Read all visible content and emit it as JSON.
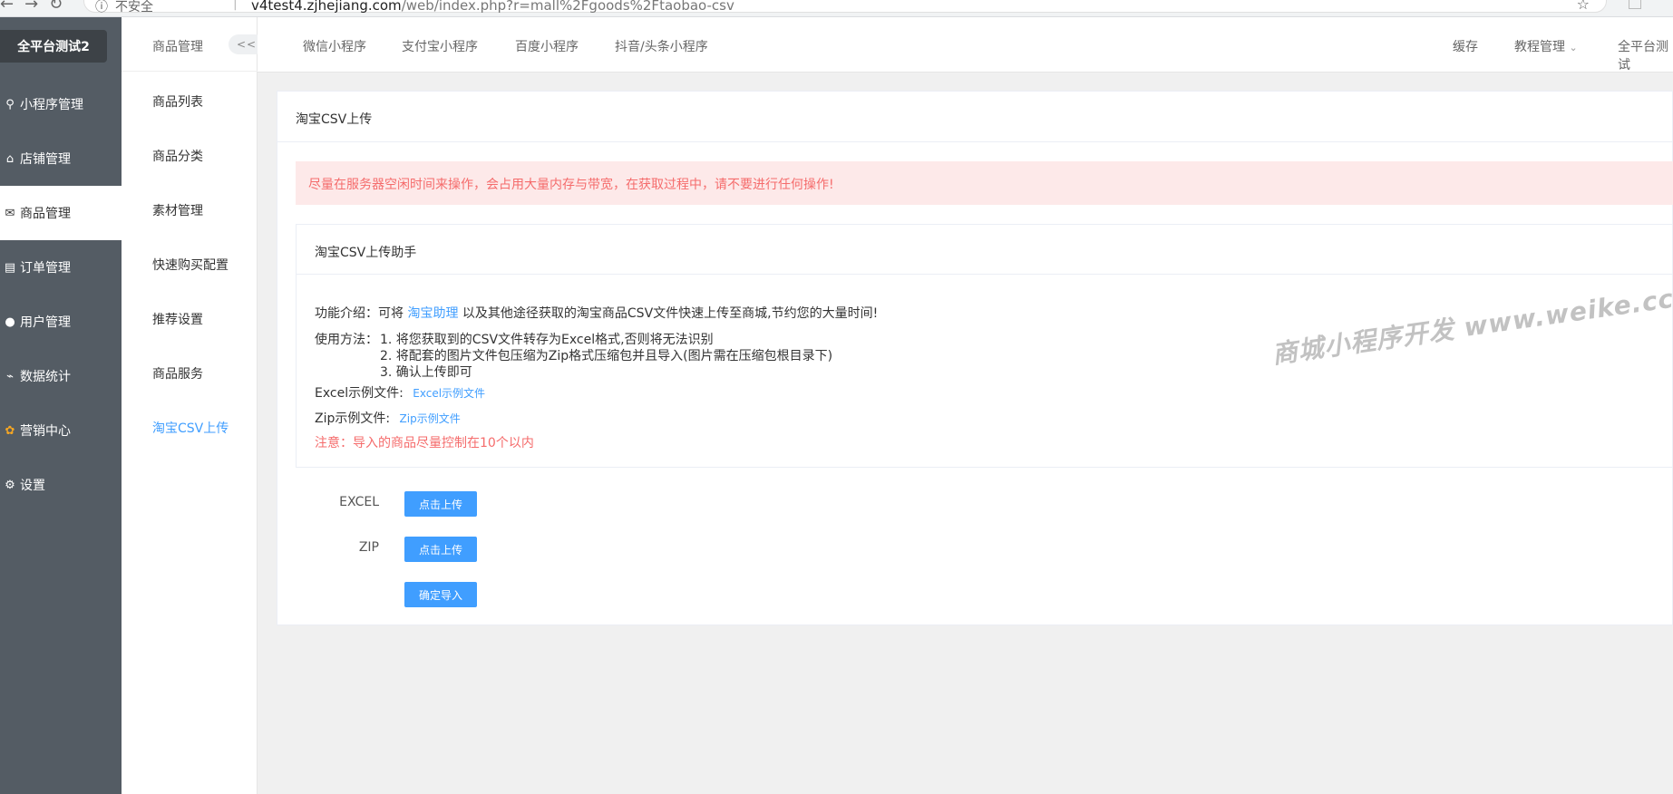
{
  "browser": {
    "secure_label": "不安全",
    "url_host": "v4test4.zjhejiang.com",
    "url_path": "/web/index.php?r=mall%2Fgoods%2Ftaobao-csv"
  },
  "sidebar": {
    "brand": "全平台测试2",
    "items": [
      {
        "label": "小程序管理",
        "icon": "link-icon"
      },
      {
        "label": "店铺管理",
        "icon": "store-icon"
      },
      {
        "label": "商品管理",
        "icon": "goods-icon"
      },
      {
        "label": "订单管理",
        "icon": "order-icon"
      },
      {
        "label": "用户管理",
        "icon": "user-icon"
      },
      {
        "label": "数据统计",
        "icon": "chart-icon"
      },
      {
        "label": "营销中心",
        "icon": "marketing-icon"
      },
      {
        "label": "设置",
        "icon": "gear-icon"
      }
    ]
  },
  "subnav": {
    "title": "商品管理",
    "collapse": "<<",
    "items": [
      "商品列表",
      "商品分类",
      "素材管理",
      "快速购买配置",
      "推荐设置",
      "商品服务",
      "淘宝CSV上传"
    ]
  },
  "topnav": {
    "tabs": [
      "微信小程序",
      "支付宝小程序",
      "百度小程序",
      "抖音/头条小程序"
    ],
    "cache": "缓存",
    "tutorial": "教程管理",
    "account": "全平台测试"
  },
  "card": {
    "title": "淘宝CSV上传",
    "alert": "尽量在服务器空闲时间来操作，会占用大量内存与带宽，在获取过程中，请不要进行任何操作!"
  },
  "helper": {
    "title": "淘宝CSV上传助手",
    "intro_prefix": "功能介绍：可将",
    "intro_link": "淘宝助理",
    "intro_suffix": "以及其他途径获取的淘宝商品CSV文件快速上传至商城,节约您的大量时间!",
    "usage_label": "使用方法：",
    "steps": [
      "1. 将您获取到的CSV文件转存为Excel格式,否则将无法识别",
      "2. 将配套的图片文件包压缩为Zip格式压缩包并且导入(图片需在压缩包根目录下)",
      "3. 确认上传即可"
    ],
    "excel_label": "Excel示例文件:",
    "excel_link": "Excel示例文件",
    "zip_label": "Zip示例文件:",
    "zip_link": "Zip示例文件",
    "note": "注意：导入的商品尽量控制在10个以内"
  },
  "form": {
    "excel_label": "EXCEL",
    "zip_label": "ZIP",
    "upload_label": "点击上传",
    "confirm_label": "确定导入"
  },
  "watermark": "商城小程序开发  www.weike.cc"
}
